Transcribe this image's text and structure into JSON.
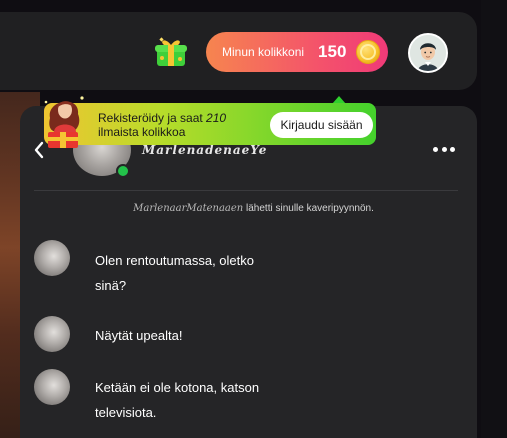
{
  "header": {
    "coins_label": "Minun kolikkoni",
    "coins_count": "150",
    "gift_icon": "gift-box-icon",
    "coin_icon": "coin-icon",
    "avatar_icon": "user-avatar"
  },
  "promo": {
    "text_before": "Rekisteröidy ja saat ",
    "text_amount": "210",
    "text_after": " ilmaista kolikkoa",
    "login_label": "Kirjaudu sisään",
    "gradient_start": "#f0c531",
    "gradient_end": "#44d12c"
  },
  "chat": {
    "contact_name": "MarlenadenaeYe",
    "online_color": "#23c24a",
    "friend_request_name": "MarlenaarMatenaaen",
    "friend_request_text": " lähetti sinulle kaveripyynnön.",
    "messages": [
      {
        "text": "Olen rentoutumassa, oletko sinä?"
      },
      {
        "text": "Näytät upealta!"
      },
      {
        "text": "Ketään ei ole kotona, katson televisiota."
      }
    ]
  },
  "colors": {
    "background": "#0f0d12",
    "panel": "#252527",
    "topbar": "#202022",
    "coins_gradient_start": "#f6854f",
    "coins_gradient_end": "#f03a78"
  }
}
